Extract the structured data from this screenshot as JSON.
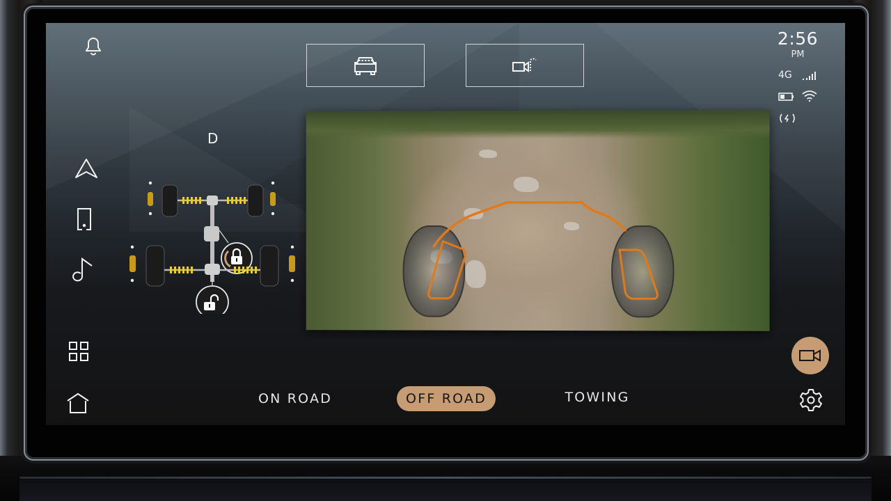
{
  "status": {
    "time": "2:56",
    "ampm": "PM",
    "network": "4G",
    "icons": [
      "signal-bars-icon",
      "battery-icon",
      "wifi-icon",
      "wireless-charging-icon"
    ]
  },
  "sidebar": {
    "items": [
      {
        "name": "notifications",
        "icon": "bell-icon"
      },
      {
        "name": "navigation",
        "icon": "navigation-arrow-icon"
      },
      {
        "name": "phone",
        "icon": "phone-icon"
      },
      {
        "name": "media",
        "icon": "music-note-icon"
      },
      {
        "name": "apps",
        "icon": "grid-icon"
      },
      {
        "name": "home",
        "icon": "home-icon"
      }
    ]
  },
  "camera_views": [
    {
      "name": "front-view",
      "icon": "car-front-icon"
    },
    {
      "name": "camera-switch",
      "icon": "camera-view-icon"
    }
  ],
  "drivetrain": {
    "gear": "D",
    "center_diff": {
      "state": "locked",
      "icon": "lock-icon",
      "lock_progress": 0.35
    },
    "rear_diff": {
      "state": "unlocked",
      "icon": "unlock-icon"
    },
    "accent_color": "#c69c74",
    "spring_color": "#e8d01c",
    "damper_color": "#c79a18"
  },
  "modes": {
    "tabs": [
      {
        "label": "ON ROAD",
        "active": false
      },
      {
        "label": "OFF ROAD",
        "active": true
      },
      {
        "label": "TOWING",
        "active": false
      }
    ],
    "accent_color": "#c69c74"
  },
  "controls": {
    "camera_button_icon": "video-camera-icon",
    "settings_icon": "gear-icon"
  },
  "camera_feed": {
    "description": "Front off-road camera view with wheel overlay and orange trajectory guide",
    "guide_color": "#e07a1a"
  }
}
